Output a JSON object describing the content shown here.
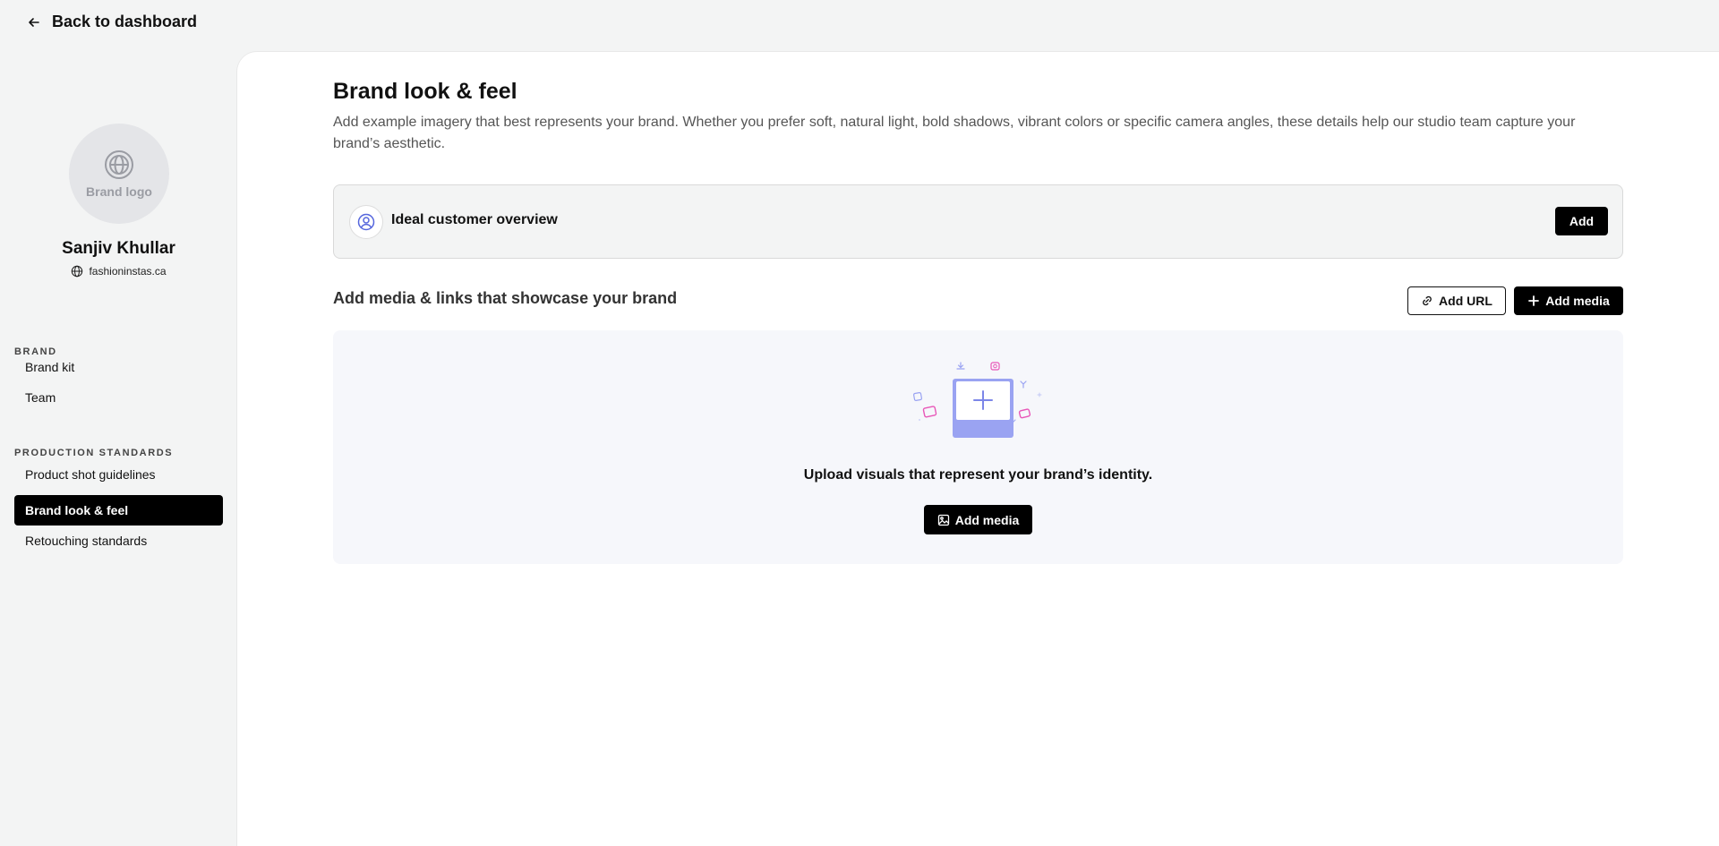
{
  "topbar": {
    "back_label": "Back to dashboard"
  },
  "profile": {
    "logo_placeholder": "Brand logo",
    "name": "Sanjiv Khullar",
    "website": "fashioninstas.ca"
  },
  "sidebar": {
    "sections": [
      {
        "label": "BRAND",
        "items": [
          {
            "label": "Brand kit"
          },
          {
            "label": "Team"
          }
        ]
      },
      {
        "label": "PRODUCTION STANDARDS",
        "items": [
          {
            "label": "Product shot guidelines"
          },
          {
            "label": "Brand look & feel",
            "active": true
          },
          {
            "label": "Retouching standards"
          }
        ]
      }
    ]
  },
  "main": {
    "title": "Brand look & feel",
    "description": "Add example imagery that best represents your brand. Whether you prefer soft, natural light, bold shadows, vibrant colors or specific camera angles, these details help our studio team capture your brand’s aesthetic.",
    "customer_card": {
      "title": "Ideal customer overview",
      "add_label": "Add"
    },
    "media": {
      "heading": "Add media & links that showcase your brand",
      "add_url_label": "Add URL",
      "add_media_label": "Add media",
      "upload_text": "Upload visuals that represent your brand’s identity.",
      "upload_button_label": "Add media"
    }
  },
  "colors": {
    "accent": "#000000",
    "illustration_purple": "#9aa3f2",
    "illustration_pink": "#e857b8",
    "panel_bg": "#f6f7fb"
  }
}
